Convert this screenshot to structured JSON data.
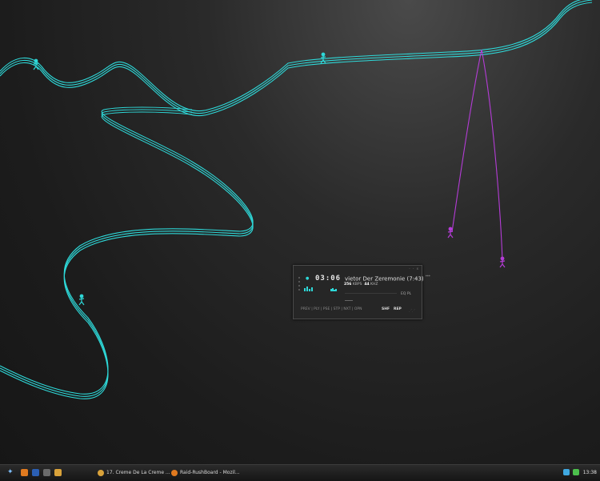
{
  "colors": {
    "rope_cyan": "#2ed8d8",
    "rope_purple": "#b43cd6",
    "background": "#1c1c1c",
    "taskbar": "#1e1e1e"
  },
  "player": {
    "time": "03:06",
    "track_title": "vietor Der Zeremonie (7:43)",
    "track_badge": "***",
    "kbps_value": "256",
    "kbps_unit": "KBPS",
    "khz_value": "44",
    "khz_unit": "KHZ",
    "eq_pl": "EQ  PL",
    "controls": "PREV | PLY | PSE | STP | NXT | OPN",
    "shuffle_label": "SHF",
    "repeat_label": "REP",
    "window_buttons": "- - x",
    "icons": [
      "play-indicator-icon",
      "window-controls-icon",
      "resize-grip-icon"
    ]
  },
  "taskbar": {
    "start_glyph": "✦",
    "quicklaunch": [
      {
        "name": "firefox-icon",
        "color": "#e07a1f"
      },
      {
        "name": "photoshop-icon",
        "color": "#2b5fb3"
      },
      {
        "name": "media-icon",
        "color": "#6b6b6b"
      },
      {
        "name": "winamp-icon",
        "color": "#d9a23a"
      }
    ],
    "tasks": [
      {
        "label": "17. Creme De La Creme ...",
        "icon": "winamp-icon",
        "color": "#d9a23a"
      },
      {
        "label": "Raid-RushBoard - Mozil...",
        "icon": "firefox-icon",
        "color": "#e07a1f"
      }
    ],
    "tray_icons": [
      {
        "name": "network-icon",
        "color": "#3fa8e0"
      },
      {
        "name": "messenger-icon",
        "color": "#4cc04c"
      }
    ],
    "clock": "13:38"
  }
}
